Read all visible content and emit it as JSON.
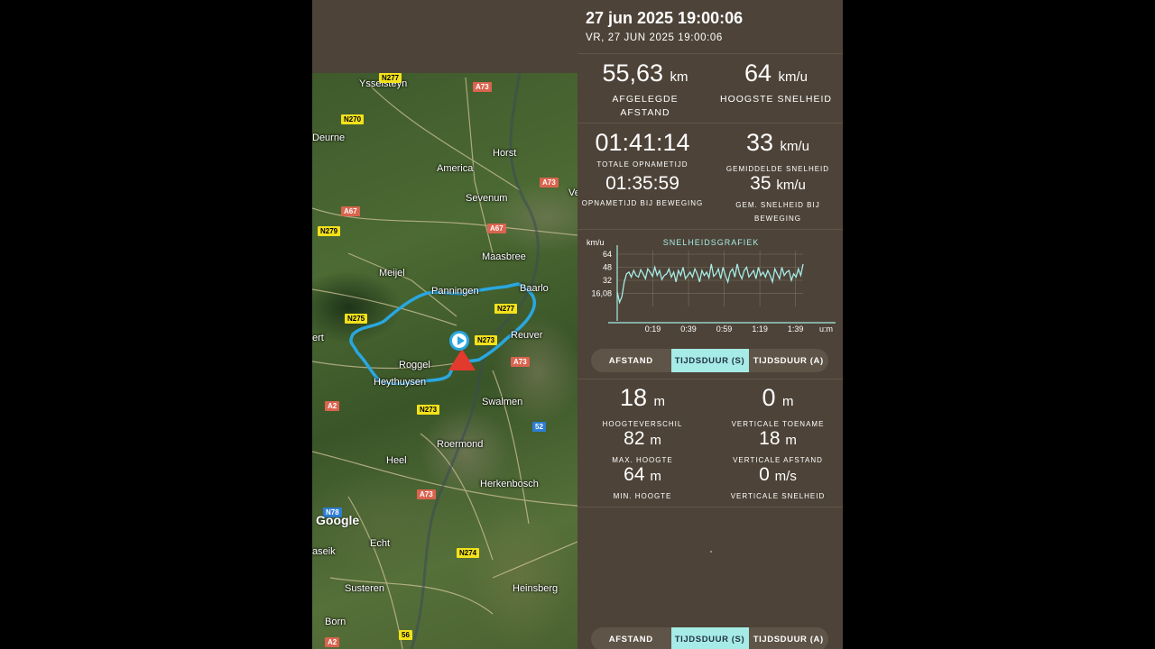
{
  "header": {
    "title": "27 jun 2025 19:00:06",
    "subtitle": "VR, 27 JUN 2025 19:00:06"
  },
  "summary": {
    "distance": {
      "value": "55,63",
      "unit": "km",
      "label": "AFGELEGDE AFSTAND"
    },
    "max_speed": {
      "value": "64",
      "unit": "km/u",
      "label": "HOOGSTE SNELHEID"
    },
    "total_time": {
      "value": "01:41:14",
      "label": "TOTALE OPNAMETIJD"
    },
    "avg_speed": {
      "value": "33",
      "unit": "km/u",
      "label": "GEMIDDELDE SNELHEID"
    },
    "moving_time": {
      "value": "01:35:59",
      "label": "OPNAMETIJD BIJ BEWEGING"
    },
    "moving_avg_speed": {
      "value": "35",
      "unit": "km/u",
      "label": "GEM. SNELHEID BIJ BEWEGING"
    }
  },
  "chart_data": {
    "type": "line",
    "title": "SNELHEIDSGRAFIEK",
    "ylabel": "km/u",
    "xlabel": "u:m",
    "y_ticks": [
      "64",
      "48",
      "32",
      "16,08"
    ],
    "x_ticks": [
      "0:19",
      "0:39",
      "0:59",
      "1:19",
      "1:39"
    ],
    "ylim": [
      0,
      64
    ],
    "xlim": [
      0,
      1.72
    ],
    "series": [
      {
        "color": "#a6ebe6",
        "values": [
          18,
          5,
          12,
          30,
          40,
          42,
          36,
          44,
          38,
          36,
          45,
          40,
          34,
          46,
          42,
          37,
          48,
          38,
          44,
          33,
          38,
          40,
          46,
          36,
          42,
          30,
          44,
          38,
          48,
          34,
          38,
          42,
          36,
          46,
          40,
          30,
          44,
          38,
          42,
          35,
          52,
          37,
          40,
          46,
          34,
          48,
          38,
          30,
          42,
          46,
          36,
          52,
          40,
          34,
          44,
          48,
          36,
          40,
          44,
          34,
          48,
          38,
          42,
          36,
          44,
          38,
          30,
          46,
          40,
          34,
          48,
          38,
          42,
          44,
          32,
          40,
          36,
          46,
          38,
          52
        ]
      }
    ],
    "grid": true
  },
  "toggle": {
    "options": [
      "AFSTAND",
      "TIJDSDUUR (S)",
      "TIJDSDUUR (A)"
    ],
    "selected": "TIJDSDUUR (S)"
  },
  "elevation": {
    "height_diff": {
      "value": "18",
      "unit": "m",
      "label": "HOOGTEVERSCHIL"
    },
    "vertical_gain": {
      "value": "0",
      "unit": "m",
      "label": "VERTICALE TOENAME"
    },
    "max_height": {
      "value": "82",
      "unit": "m",
      "label": "MAX. HOOGTE"
    },
    "vertical_distance": {
      "value": "18",
      "unit": "m",
      "label": "VERTICALE AFSTAND"
    },
    "min_height": {
      "value": "64",
      "unit": "m",
      "label": "MIN. HOOGTE"
    },
    "vertical_speed": {
      "value": "0",
      "unit": "m/s",
      "label": "VERTICALE SNELHEID"
    }
  },
  "map": {
    "places": [
      "Ysselsteyn",
      "Deurne",
      "Horst",
      "America",
      "Sevenum",
      "Meijel",
      "Maasbree",
      "Panningen",
      "Baarlo",
      "Reuver",
      "Roggel",
      "Heythuysen",
      "Swalmen",
      "Roermond",
      "Heel",
      "Herkenbosch",
      "Echt",
      "Susteren",
      "Heinsberg",
      "Born",
      "ert",
      "aseik",
      "Ve"
    ],
    "roads": [
      "N277",
      "A73",
      "N270",
      "A73",
      "A67",
      "N279",
      "A67",
      "N277",
      "N275",
      "N273",
      "A73",
      "A2",
      "N273",
      "52",
      "A73",
      "N78",
      "N274",
      "56",
      "A2"
    ],
    "attribution": "Google"
  }
}
